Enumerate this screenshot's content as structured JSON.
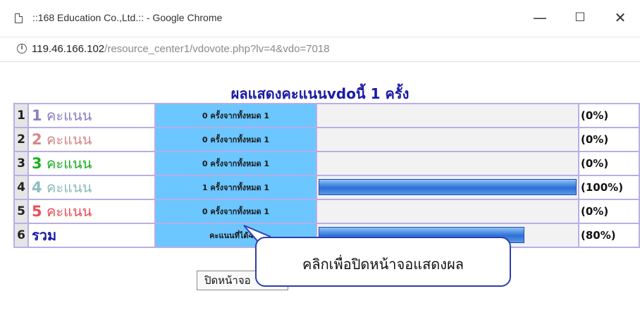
{
  "window": {
    "title": "::168 Education Co.,Ltd.:: - Google Chrome",
    "minimize_glyph": "—",
    "maximize_glyph": "☐",
    "close_glyph": "✕"
  },
  "address": {
    "host": "119.46.166.102",
    "path": "/resource_center1/vdovote.php?lv=4&vdo=7018"
  },
  "page": {
    "title": "ผลแสดงคะแนนvdoนี้ 1 ครั้ง",
    "rows": [
      {
        "no": "1",
        "score": "1",
        "label": " คะแนน",
        "color": "#8a7fc4",
        "count": "0 ครั้งจากทั้งหมด 1",
        "percent": "(0%)",
        "fill": 0
      },
      {
        "no": "2",
        "score": "2",
        "label": " คะแนน",
        "color": "#d4888a",
        "count": "0 ครั้งจากทั้งหมด 1",
        "percent": "(0%)",
        "fill": 0
      },
      {
        "no": "3",
        "score": "3",
        "label": " คะแนน",
        "color": "#19b022",
        "count": "0 ครั้งจากทั้งหมด 1",
        "percent": "(0%)",
        "fill": 0
      },
      {
        "no": "4",
        "score": "4",
        "label": " คะแนน",
        "color": "#8ebcbf",
        "count": "1 ครั้งจากทั้งหมด 1",
        "percent": "(100%)",
        "fill": 100
      },
      {
        "no": "5",
        "score": "5",
        "label": " คะแนน",
        "color": "#e8505a",
        "count": "0 ครั้งจากทั้งหมด 1",
        "percent": "(0%)",
        "fill": 0
      }
    ],
    "total": {
      "no": "6",
      "label": "รวม",
      "color": "#1a1aa8",
      "count": "คะแนนที่ได้4/5",
      "percent": "(80%)",
      "fill": 80
    },
    "close_button": "ปิดหน้าจอ",
    "tooltip": "คลิกเพื่อปิดหน้าจอแสดงผล"
  }
}
